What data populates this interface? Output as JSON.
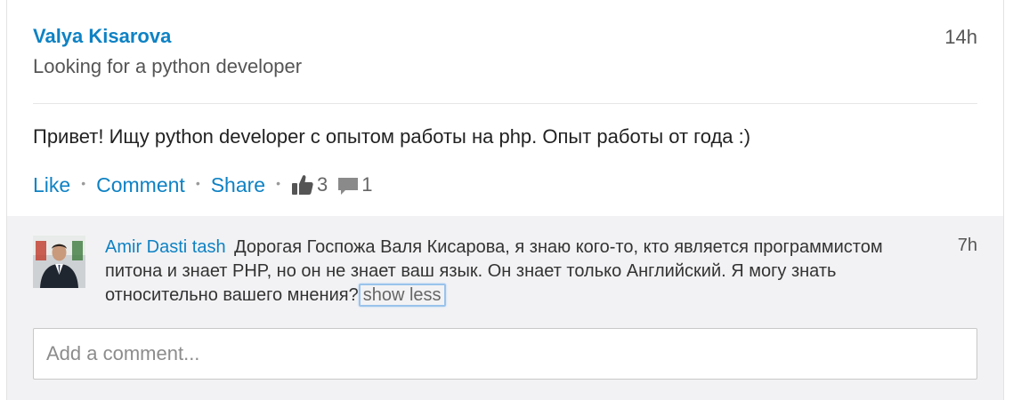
{
  "post": {
    "author": "Valya Kisarova",
    "time": "14h",
    "headline": "Looking for a python developer",
    "body": "Привет! Ищу python developer с опытом работы на php. Опыт работы от года :)"
  },
  "actions": {
    "like": "Like",
    "comment": "Comment",
    "share": "Share",
    "separator": "•",
    "likes_count": "3",
    "comments_count": "1",
    "icons": {
      "like": "thumbs-up-icon",
      "comment": "speech-bubble-icon"
    }
  },
  "comment": {
    "author": "Amir Dasti tash",
    "text": "Дорогая Госпожа Валя Кисарова, я знаю кого-то, кто является программистом питона и знает PHP, но он не знает ваш язык. Он знает только Английский. Я могу знать относительно вашего мнения?",
    "show_less": "show less",
    "time": "7h"
  },
  "add_comment": {
    "placeholder": "Add a comment..."
  },
  "colors": {
    "link": "#0e82c4",
    "muted": "#555555",
    "comments_bg": "#f2f2f4",
    "focus_ring": "#9ac3ec"
  }
}
